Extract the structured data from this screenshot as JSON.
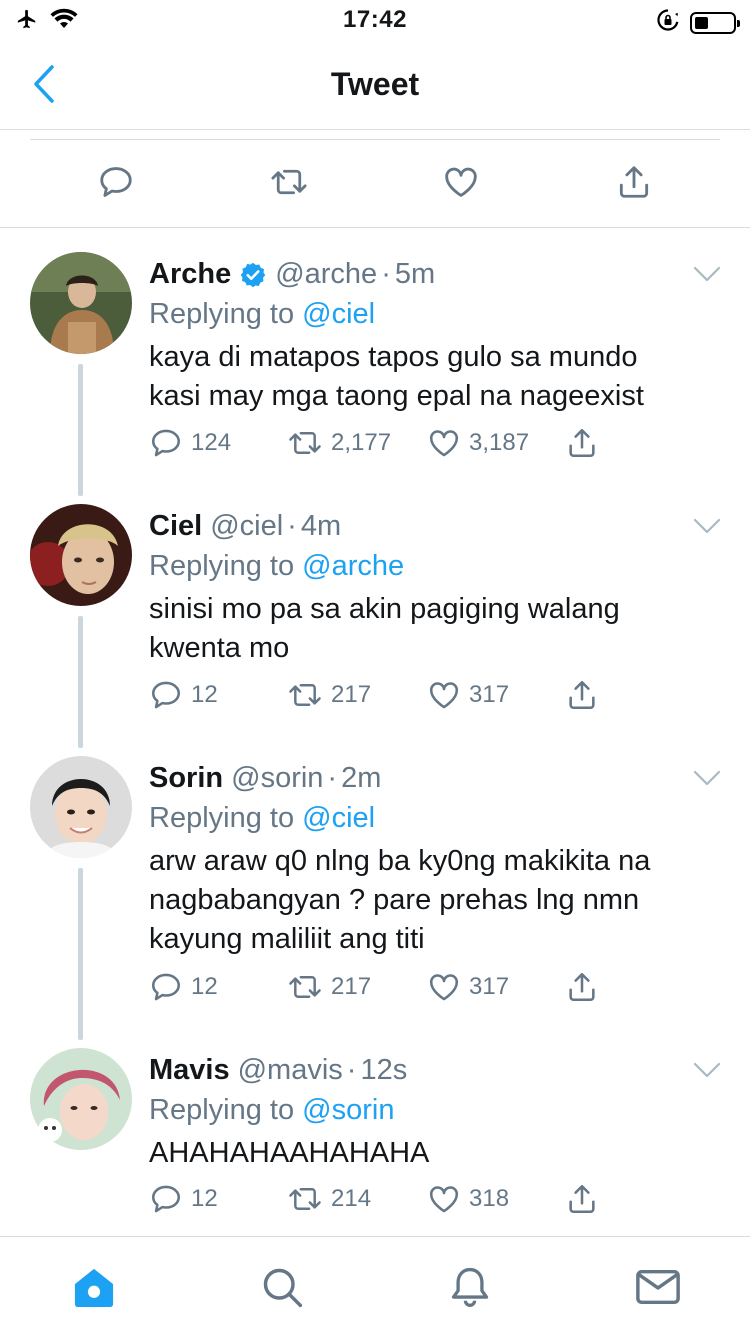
{
  "status_bar": {
    "time": "17:42",
    "battery_level": 0.35
  },
  "header": {
    "title": "Tweet"
  },
  "colors": {
    "accent": "#1da1f2",
    "secondary_text": "#657786",
    "divider": "#d8dde2",
    "thread_line": "#ccd6dd"
  },
  "main_actions": [
    "reply-icon",
    "retweet-icon",
    "like-icon",
    "share-icon"
  ],
  "replies": [
    {
      "name": "Arche",
      "verified": true,
      "handle": "@arche",
      "dot": "·",
      "time": "5m",
      "replying_prefix": "Replying to ",
      "replying_to": "@ciel",
      "text": "kaya di matapos tapos gulo sa mundo\nkasi may mga taong epal na nageexist",
      "replies": "124",
      "retweets": "2,177",
      "likes": "3,187"
    },
    {
      "name": "Ciel",
      "verified": false,
      "handle": "@ciel",
      "dot": "·",
      "time": "4m",
      "replying_prefix": "Replying to ",
      "replying_to": "@arche",
      "text": "sinisi mo pa sa akin pagiging walang\nkwenta mo",
      "replies": "12",
      "retweets": "217",
      "likes": "317"
    },
    {
      "name": "Sorin",
      "verified": false,
      "handle": "@sorin",
      "dot": "·",
      "time": "2m",
      "replying_prefix": "Replying to ",
      "replying_to": "@ciel",
      "text": "arw araw q0 nlng ba ky0ng makikita na\nnagbabangyan ? pare prehas lng nmn\nkayung maliliit ang titi",
      "replies": "12",
      "retweets": "217",
      "likes": "317"
    },
    {
      "name": "Mavis",
      "verified": false,
      "handle": "@mavis",
      "dot": "·",
      "time": "12s",
      "replying_prefix": "Replying to ",
      "replying_to": "@sorin",
      "text": "AHAHAHAAHAHAHA",
      "replies": "12",
      "retweets": "214",
      "likes": "318"
    }
  ],
  "tab_bar": [
    "home-icon",
    "search-icon",
    "notifications-icon",
    "messages-icon"
  ]
}
